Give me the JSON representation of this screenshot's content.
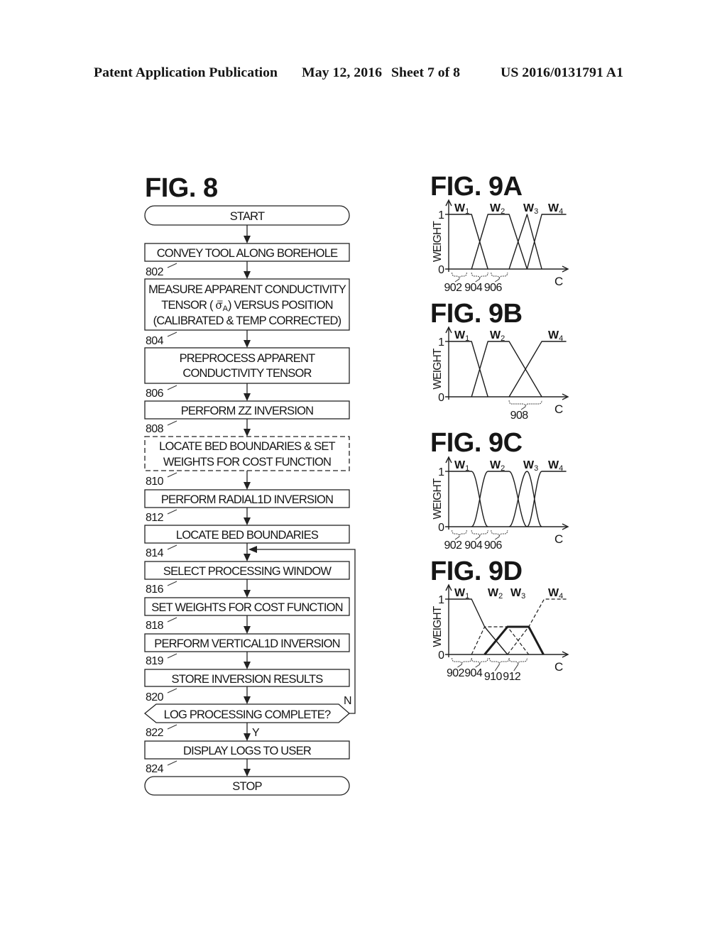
{
  "header": {
    "publication_type": "Patent Application Publication",
    "date": "May 12, 2016",
    "sheet": "Sheet 7 of 8",
    "publication_number": "US 2016/0131791 A1"
  },
  "fig8": {
    "title": "FIG. 8",
    "start": "START",
    "stop": "STOP",
    "steps": [
      {
        "ref": "802",
        "type": "process",
        "lines": [
          "CONVEY TOOL ALONG BOREHOLE"
        ]
      },
      {
        "ref": "804",
        "type": "process",
        "lines": [
          "MEASURE APPARENT CONDUCTIVITY",
          {
            "prefix": "TENSOR ( ",
            "symbol": "σ̿",
            "subscript": "A",
            "suffix": ") VERSUS POSITION"
          },
          "(CALIBRATED & TEMP CORRECTED)"
        ]
      },
      {
        "ref": "806",
        "type": "process",
        "lines": [
          "PREPROCESS APPARENT",
          "CONDUCTIVITY TENSOR"
        ]
      },
      {
        "ref": "808",
        "type": "process",
        "lines": [
          "PERFORM ZZ INVERSION"
        ]
      },
      {
        "ref": "810",
        "type": "process",
        "optional": true,
        "lines": [
          "LOCATE BED BOUNDARIES & SET",
          "WEIGHTS FOR COST FUNCTION"
        ]
      },
      {
        "ref": "812",
        "type": "process",
        "lines": [
          "PERFORM RADIAL1D INVERSION"
        ]
      },
      {
        "ref": "814",
        "type": "process",
        "lines": [
          "LOCATE BED BOUNDARIES"
        ]
      },
      {
        "ref": "816",
        "type": "process",
        "lines": [
          "SELECT PROCESSING WINDOW"
        ]
      },
      {
        "ref": "818",
        "type": "process",
        "lines": [
          "SET WEIGHTS FOR COST FUNCTION"
        ]
      },
      {
        "ref": "819",
        "type": "process",
        "lines": [
          "PERFORM VERTICAL1D INVERSION"
        ]
      },
      {
        "ref": "820",
        "type": "process",
        "lines": [
          "STORE INVERSION RESULTS"
        ]
      },
      {
        "ref": "822",
        "type": "decision",
        "lines": [
          "LOG PROCESSING COMPLETE?"
        ],
        "yes": "Y",
        "no": "N",
        "no_loops_to": "816"
      },
      {
        "ref": "824",
        "type": "process",
        "lines": [
          "DISPLAY LOGS TO USER"
        ]
      }
    ]
  },
  "chart_data": [
    {
      "title": "FIG. 9A",
      "type": "line",
      "xlabel": "C",
      "ylabel": "WEIGHT",
      "yticks": [
        "0",
        "1"
      ],
      "ylim": [
        0,
        1
      ],
      "xlim": [
        0,
        7.3
      ],
      "interpolation": "linear",
      "series": [
        {
          "name": "W1",
          "name_base": "W",
          "name_sub": "1",
          "style": "solid",
          "points": [
            [
              0,
              1
            ],
            [
              1.4,
              1
            ],
            [
              2.4,
              0
            ]
          ]
        },
        {
          "name": "W2",
          "name_base": "W",
          "name_sub": "2",
          "style": "solid",
          "points": [
            [
              1.4,
              0
            ],
            [
              2.4,
              1
            ],
            [
              3.7,
              1
            ],
            [
              4.8,
              0
            ]
          ]
        },
        {
          "name": "W3",
          "name_base": "W",
          "name_sub": "3",
          "style": "solid",
          "points": [
            [
              3.7,
              0
            ],
            [
              4.8,
              1
            ],
            [
              5.7,
              0
            ]
          ]
        },
        {
          "name": "W4",
          "name_base": "W",
          "name_sub": "4",
          "style": "solid",
          "points": [
            [
              4.8,
              0
            ],
            [
              5.7,
              1
            ],
            [
              7.2,
              1
            ]
          ]
        }
      ],
      "annotations": [
        {
          "label": "902",
          "x_range": [
            0.2,
            1.1
          ]
        },
        {
          "label": "904",
          "x_range": [
            1.4,
            2.4
          ]
        },
        {
          "label": "906",
          "x_range": [
            2.6,
            3.6
          ]
        }
      ]
    },
    {
      "title": "FIG. 9B",
      "type": "line",
      "xlabel": "C",
      "ylabel": "WEIGHT",
      "yticks": [
        "0",
        "1"
      ],
      "ylim": [
        0,
        1
      ],
      "xlim": [
        0,
        7.3
      ],
      "interpolation": "linear",
      "series": [
        {
          "name": "W1",
          "name_base": "W",
          "name_sub": "1",
          "style": "solid",
          "points": [
            [
              0,
              1
            ],
            [
              1.4,
              1
            ],
            [
              2.4,
              0
            ]
          ]
        },
        {
          "name": "W2",
          "name_base": "W",
          "name_sub": "2",
          "style": "solid",
          "points": [
            [
              1.4,
              0
            ],
            [
              2.4,
              1
            ],
            [
              3.7,
              1
            ],
            [
              5.7,
              0
            ]
          ]
        },
        {
          "name": "W4",
          "name_base": "W",
          "name_sub": "4",
          "style": "solid",
          "points": [
            [
              3.7,
              0
            ],
            [
              5.7,
              1
            ],
            [
              7.2,
              1
            ]
          ]
        }
      ],
      "annotations": [
        {
          "label": "908",
          "x_range": [
            3.7,
            5.7
          ]
        }
      ]
    },
    {
      "title": "FIG. 9C",
      "type": "line",
      "xlabel": "C",
      "ylabel": "WEIGHT",
      "yticks": [
        "0",
        "1"
      ],
      "ylim": [
        0,
        1
      ],
      "xlim": [
        0,
        7.3
      ],
      "interpolation": "smooth",
      "series": [
        {
          "name": "W1",
          "name_base": "W",
          "name_sub": "1",
          "style": "solid",
          "points": [
            [
              0,
              1
            ],
            [
              1.4,
              1
            ],
            [
              2.4,
              0
            ]
          ]
        },
        {
          "name": "W2",
          "name_base": "W",
          "name_sub": "2",
          "style": "solid",
          "points": [
            [
              1.4,
              0
            ],
            [
              2.4,
              1
            ],
            [
              3.7,
              1
            ],
            [
              4.8,
              0
            ]
          ]
        },
        {
          "name": "W3",
          "name_base": "W",
          "name_sub": "3",
          "style": "solid",
          "points": [
            [
              3.7,
              0
            ],
            [
              4.8,
              1
            ],
            [
              5.7,
              0
            ]
          ]
        },
        {
          "name": "W4",
          "name_base": "W",
          "name_sub": "4",
          "style": "solid",
          "points": [
            [
              4.8,
              0
            ],
            [
              5.7,
              1
            ],
            [
              7.2,
              1
            ]
          ]
        }
      ],
      "annotations": [
        {
          "label": "902",
          "x_range": [
            0.2,
            1.1
          ]
        },
        {
          "label": "904",
          "x_range": [
            1.4,
            2.4
          ]
        },
        {
          "label": "906",
          "x_range": [
            2.6,
            3.6
          ]
        }
      ]
    },
    {
      "title": "FIG. 9D",
      "type": "line",
      "xlabel": "C",
      "ylabel": "WEIGHT",
      "yticks": [
        "0",
        "1"
      ],
      "ylim": [
        0,
        1
      ],
      "xlim": [
        0,
        7.3
      ],
      "interpolation": "linear",
      "series": [
        {
          "name": "W1",
          "name_base": "W",
          "name_sub": "1",
          "style": "solid",
          "points": [
            [
              0,
              1
            ],
            [
              1.4,
              1
            ],
            [
              2.2,
              0.5
            ],
            [
              3.6,
              0
            ]
          ]
        },
        {
          "name": "W2",
          "name_base": "W",
          "name_sub": "2",
          "style": "dashed",
          "points": [
            [
              1.4,
              0
            ],
            [
              2.2,
              0.5
            ],
            [
              3.6,
              0.5
            ],
            [
              4.9,
              0
            ]
          ]
        },
        {
          "name": "W3",
          "name_base": "W",
          "name_sub": "3",
          "style": "bold",
          "points": [
            [
              2.2,
              0
            ],
            [
              3.6,
              0.5
            ],
            [
              4.9,
              0.5
            ],
            [
              5.8,
              0
            ]
          ]
        },
        {
          "name": "W4",
          "name_base": "W",
          "name_sub": "4",
          "style": "dashed",
          "points": [
            [
              3.6,
              0
            ],
            [
              4.9,
              0.5
            ],
            [
              5.85,
              1
            ],
            [
              7.2,
              1
            ]
          ]
        }
      ],
      "annotations": [
        {
          "label": "902",
          "x_range": [
            0.2,
            1.4
          ]
        },
        {
          "label": "904",
          "x_range": [
            1.4,
            2.4
          ]
        },
        {
          "label": "910",
          "x_range": [
            2.5,
            3.7
          ]
        },
        {
          "label": "912",
          "x_range": [
            3.7,
            4.8
          ]
        }
      ]
    }
  ]
}
